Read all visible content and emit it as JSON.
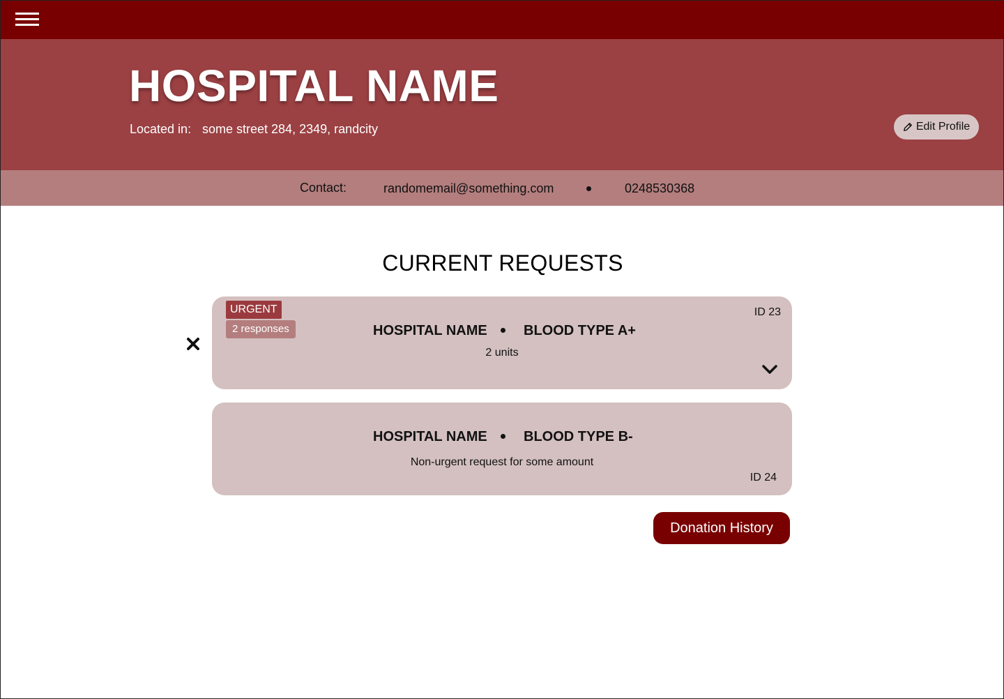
{
  "header": {
    "menu_icon": "hamburger-menu-icon",
    "title": "HOSPITAL NAME",
    "location_label": "Located in:",
    "location_value": "some street 284, 2349, randcity",
    "edit_profile_label": "Edit Profile",
    "edit_icon": "pencil-icon"
  },
  "contact": {
    "label": "Contact:",
    "email": "randomemail@something.com",
    "phone": "0248530368"
  },
  "requests": {
    "title": "CURRENT REQUESTS",
    "items": [
      {
        "urgent_badge": "URGENT",
        "responses_badge": "2 responses",
        "id": "ID 23",
        "hospital": "HOSPITAL NAME",
        "blood_type": "BLOOD TYPE A+",
        "detail": "2 units"
      },
      {
        "id": "ID 24",
        "hospital": "HOSPITAL NAME",
        "blood_type": "BLOOD TYPE B-",
        "detail": "Non-urgent request for some amount"
      }
    ]
  },
  "actions": {
    "donation_history_label": "Donation History"
  },
  "colors": {
    "topbar": "#790000",
    "hero": "#9b4043",
    "contact_bar": "#b47e7e",
    "card": "#d4c0c0",
    "urgent_badge": "#9b3a3e",
    "primary_button": "#790000"
  }
}
